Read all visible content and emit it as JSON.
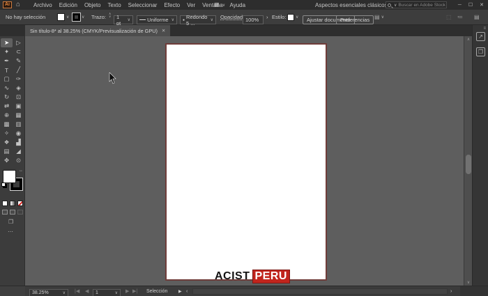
{
  "colors": {
    "accent_red": "#c1251d",
    "artboard_border": "#6f3d3a",
    "paper": "#ffffff"
  },
  "menubar": {
    "logo": "Ai",
    "items": [
      "Archivo",
      "Edición",
      "Objeto",
      "Texto",
      "Seleccionar",
      "Efecto",
      "Ver",
      "Ventana",
      "Ayuda"
    ],
    "workspace_label": "Aspectos esenciales clásicos",
    "search_placeholder": "Buscar en Adobe Stock"
  },
  "controlbar": {
    "selection_status": "No hay selección",
    "stroke_label": "Trazo:",
    "stroke_width": "1 pt",
    "variable_width_profile": "Uniforme",
    "brush_definition": "Redondo 5 ...",
    "opacity_label": "Opacidad:",
    "opacity_value": "100%",
    "style_label": "Estilo:",
    "fit_document_button": "Ajustar documento",
    "preferences_button": "Preferencias"
  },
  "tabbar": {
    "title": "Sin título-8* al 38.25% (CMYK/Previsualización de GPU)"
  },
  "toolbar": {
    "tools": [
      {
        "name": "selection-tool",
        "glyph": "➤",
        "active": true
      },
      {
        "name": "direct-selection-tool",
        "glyph": "▷"
      },
      {
        "name": "magic-wand-tool",
        "glyph": "✦"
      },
      {
        "name": "lasso-tool",
        "glyph": "⊂"
      },
      {
        "name": "pen-tool",
        "glyph": "✒"
      },
      {
        "name": "curvature-tool",
        "glyph": "✎"
      },
      {
        "name": "type-tool",
        "glyph": "T"
      },
      {
        "name": "line-segment-tool",
        "glyph": "╱"
      },
      {
        "name": "rectangle-tool",
        "glyph": "▢"
      },
      {
        "name": "paintbrush-tool",
        "glyph": "✑"
      },
      {
        "name": "shaper-tool",
        "glyph": "∿"
      },
      {
        "name": "eraser-tool",
        "glyph": "◈"
      },
      {
        "name": "rotate-tool",
        "glyph": "↻"
      },
      {
        "name": "scale-tool",
        "glyph": "⊡"
      },
      {
        "name": "width-tool",
        "glyph": "⇄"
      },
      {
        "name": "free-transform-tool",
        "glyph": "▣"
      },
      {
        "name": "shape-builder-tool",
        "glyph": "⊕"
      },
      {
        "name": "perspective-grid-tool",
        "glyph": "▦"
      },
      {
        "name": "mesh-tool",
        "glyph": "▩"
      },
      {
        "name": "gradient-tool",
        "glyph": "▥"
      },
      {
        "name": "eyedropper-tool",
        "glyph": "✧"
      },
      {
        "name": "blend-tool",
        "glyph": "◉"
      },
      {
        "name": "symbol-sprayer-tool",
        "glyph": "❖"
      },
      {
        "name": "graph-tool",
        "glyph": "▟"
      },
      {
        "name": "artboard-tool",
        "glyph": "▤"
      },
      {
        "name": "slice-tool",
        "glyph": "◢"
      },
      {
        "name": "hand-tool",
        "glyph": "✥"
      },
      {
        "name": "zoom-tool",
        "glyph": "⊙"
      }
    ],
    "more_label": "⋯"
  },
  "canvas": {
    "watermark_primary": "ACIST",
    "watermark_secondary": "PERU"
  },
  "statusbar": {
    "zoom_level": "38.25%",
    "artboard_number": "1",
    "status_label": "Selección"
  },
  "icons": {
    "home": "⌂",
    "workspace_grid": "▦",
    "chevron_down": "∨",
    "chevron_up": "∧",
    "minimize": "─",
    "maximize": "☐",
    "close": "✕",
    "swap": "↔",
    "stepper_up": "∧",
    "stepper_down": "∨",
    "angle_right": "›",
    "angle_left": "‹",
    "nav_first": "|◀",
    "nav_prev": "◀",
    "nav_next": "▶",
    "nav_last": "▶|",
    "menu_arrow": "▶",
    "screen_mode": "❐",
    "export": "↗",
    "artboards_panel": "❐",
    "collapse_panels": "≡",
    "transform_panel": "⬚",
    "arrange_panel": "≔",
    "properties_panel": "▤",
    "flyout_panel": "▤",
    "brush_dot": "●"
  }
}
